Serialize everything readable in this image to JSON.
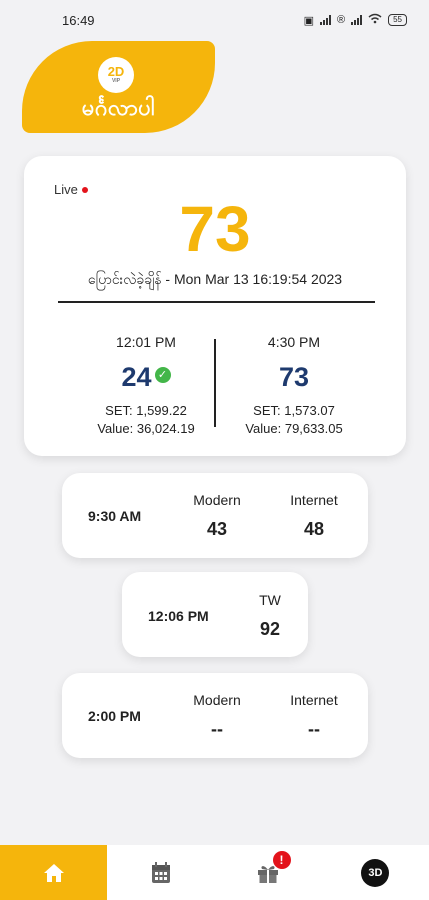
{
  "status_bar": {
    "time": "16:49",
    "battery": "55"
  },
  "logo": {
    "badge_text": "2D",
    "badge_sub": "VIP",
    "title": "မင်္ဂလာပါ"
  },
  "main": {
    "live_label": "Live",
    "live_number": "73",
    "updated": "ပြောင်းလဲခဲ့ချိန် - Mon Mar 13 16:19:54 2023",
    "morning": {
      "time": "12:01 PM",
      "number": "24",
      "set": "SET: 1,599.22",
      "value": "Value: 36,024.19"
    },
    "evening": {
      "time": "4:30 PM",
      "number": "73",
      "set": "SET: 1,573.07",
      "value": "Value: 79,633.05"
    }
  },
  "sessions": [
    {
      "time": "9:30 AM",
      "label1": "Modern",
      "value1": "43",
      "label2": "Internet",
      "value2": "48"
    },
    {
      "time": "12:06 PM",
      "label1": "TW",
      "value1": "92"
    },
    {
      "time": "2:00 PM",
      "label1": "Modern",
      "value1": "--",
      "label2": "Internet",
      "value2": "--"
    }
  ],
  "nav": {
    "badge_count": "!",
    "three_d_label": "3D"
  },
  "colors": {
    "accent": "#f5b50c",
    "number_blue": "#1e3a6e",
    "live_red": "#e3131b",
    "check_green": "#43b649"
  }
}
